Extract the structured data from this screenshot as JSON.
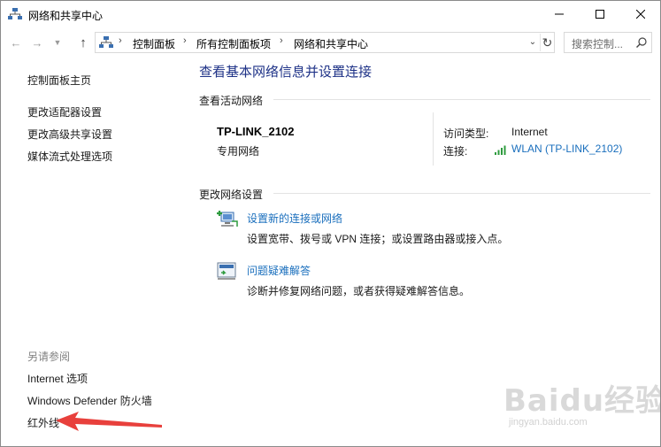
{
  "window": {
    "title": "网络和共享中心"
  },
  "address": {
    "crumbs": [
      "控制面板",
      "所有控制面板项",
      "网络和共享中心"
    ],
    "search_placeholder": "搜索控制..."
  },
  "sidebar": {
    "home": "控制面板主页",
    "links": [
      "更改适配器设置",
      "更改高级共享设置",
      "媒体流式处理选项"
    ],
    "see_also_heading": "另请参阅",
    "see_also": [
      "Internet 选项",
      "Windows Defender 防火墙",
      "红外线"
    ]
  },
  "main": {
    "title": "查看基本网络信息并设置连接",
    "active_heading": "查看活动网络",
    "network": {
      "name": "TP-LINK_2102",
      "category": "专用网络",
      "access_type_label": "访问类型:",
      "access_type_value": "Internet",
      "connection_label": "连接:",
      "connection_value": "WLAN (TP-LINK_2102)"
    },
    "change_heading": "更改网络设置",
    "tasks": [
      {
        "icon": "new-connection-icon",
        "title": "设置新的连接或网络",
        "desc": "设置宽带、拨号或 VPN 连接；或设置路由器或接入点。"
      },
      {
        "icon": "troubleshoot-icon",
        "title": "问题疑难解答",
        "desc": "诊断并修复网络问题，或者获得疑难解答信息。"
      }
    ]
  },
  "watermark": {
    "main": "Baidu经验",
    "sub": "jingyan.baidu.com"
  },
  "colors": {
    "link": "#1a6fbd",
    "title": "#1e3287",
    "arrow": "#e8403c"
  }
}
